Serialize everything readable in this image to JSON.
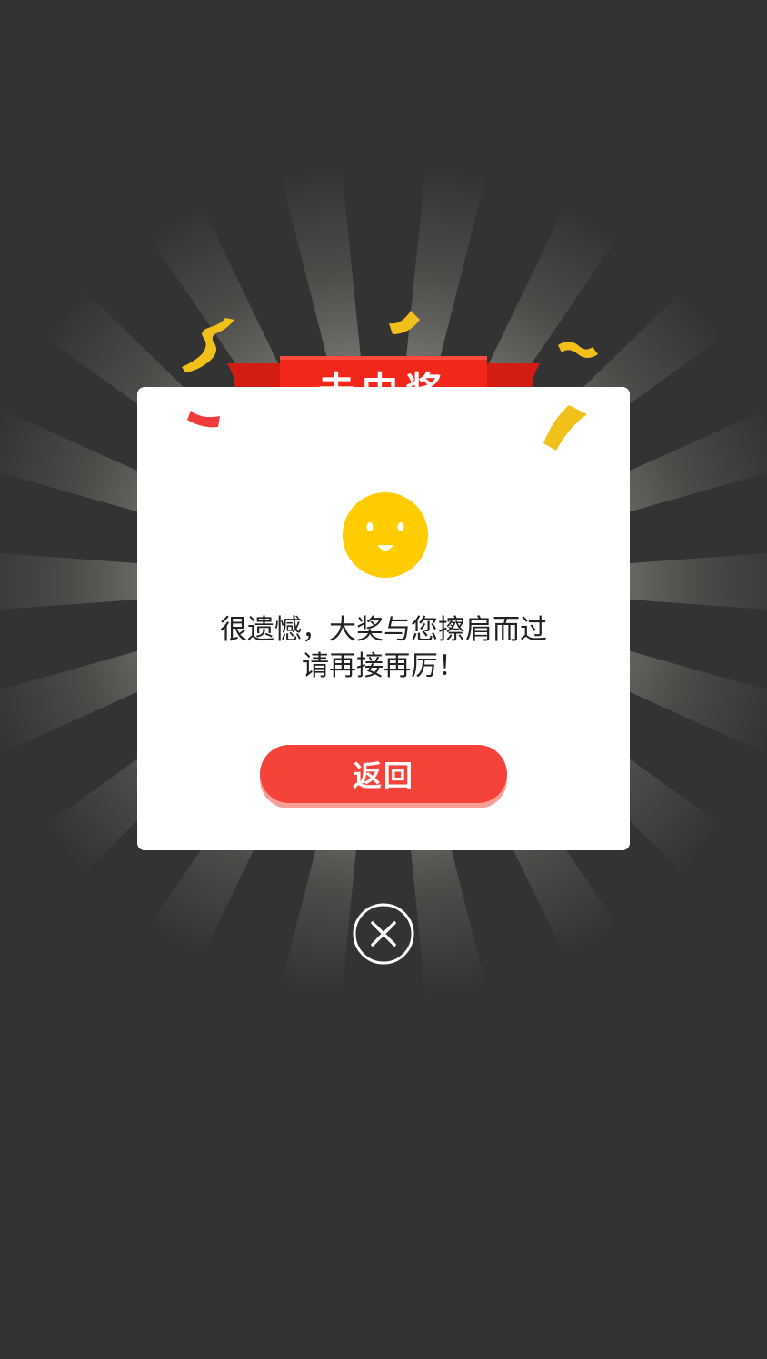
{
  "dialog": {
    "title": "未中奖",
    "message_line1": "很遗憾，大奖与您擦肩而过",
    "message_line2": "请再接再厉！",
    "back_label": "返回"
  },
  "icons": {
    "face": "smiley-face-icon",
    "close": "close-circle-icon"
  },
  "colors": {
    "background": "#333333",
    "ribbon_red": "#f1271b",
    "button_red": "#f5433a",
    "smiley_yellow": "#ffcc00",
    "confetti_gold": "#f2c01b"
  }
}
